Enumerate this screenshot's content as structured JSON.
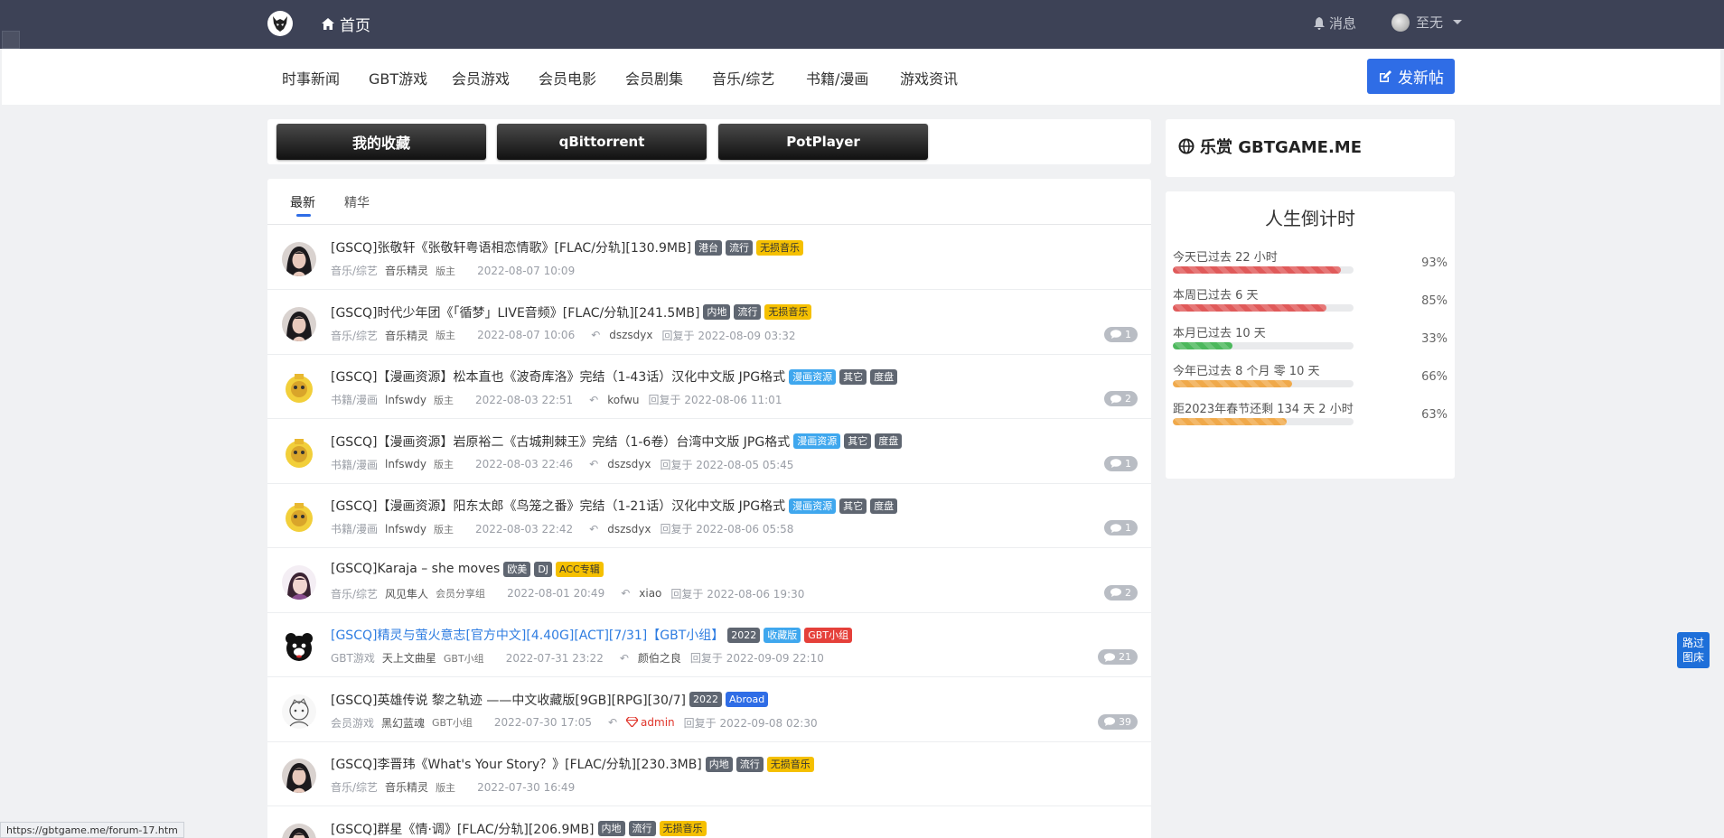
{
  "header": {
    "home_label": "首页",
    "messages_label": "消息",
    "username": "至无"
  },
  "nav": {
    "items": [
      "时事新闻",
      "GBT游戏",
      "会员游戏",
      "会员电影",
      "会员剧集",
      "音乐/综艺",
      "书籍/漫画",
      "游戏资讯"
    ],
    "post_button": "发新帖"
  },
  "quick_buttons": [
    "我的收藏",
    "qBittorrent",
    "PotPlayer"
  ],
  "tabs": [
    "最新",
    "精华"
  ],
  "threads": [
    {
      "title": "[GSCQ]张敬轩《张敬轩粤语相恋情歌》[FLAC/分轨][130.9MB]",
      "link": false,
      "tags": [
        {
          "t": "港台",
          "c": "#5f6671"
        },
        {
          "t": "流行",
          "c": "#5f6671"
        },
        {
          "t": "无损音乐",
          "c": "#f5c000",
          "dark": true
        }
      ],
      "forum": "音乐/综艺",
      "author": "音乐精灵",
      "group": "版主",
      "date": "2022-08-07 10:09",
      "replier": "",
      "reply_date": "",
      "count": "",
      "avatar": "woman"
    },
    {
      "title": "[GSCQ]时代少年团《「循梦」LIVE音频》[FLAC/分轨][241.5MB]",
      "link": false,
      "tags": [
        {
          "t": "内地",
          "c": "#5f6671"
        },
        {
          "t": "流行",
          "c": "#5f6671"
        },
        {
          "t": "无损音乐",
          "c": "#f5c000",
          "dark": true
        }
      ],
      "forum": "音乐/综艺",
      "author": "音乐精灵",
      "group": "版主",
      "date": "2022-08-07 10:06",
      "replier": "dszsdyx",
      "reply_date": "回复于 2022-08-09 03:32",
      "count": "1",
      "avatar": "woman"
    },
    {
      "title": "[GSCQ]【漫画资源】松本直也《波奇库洛》完结（1-43话）汉化中文版 JPG格式",
      "link": false,
      "tags": [
        {
          "t": "漫画资源",
          "c": "#3fa7ee"
        },
        {
          "t": "其它",
          "c": "#5f6671"
        },
        {
          "t": "度盘",
          "c": "#5f6671"
        }
      ],
      "forum": "书籍/漫画",
      "author": "lnfswdy",
      "group": "版主",
      "date": "2022-08-03 22:51",
      "replier": "kofwu",
      "reply_date": "回复于 2022-08-06 11:01",
      "count": "2",
      "avatar": "yellow"
    },
    {
      "title": "[GSCQ]【漫画资源】岩原裕二《古城荆棘王》完结（1-6卷）台湾中文版 JPG格式",
      "link": false,
      "tags": [
        {
          "t": "漫画资源",
          "c": "#3fa7ee"
        },
        {
          "t": "其它",
          "c": "#5f6671"
        },
        {
          "t": "度盘",
          "c": "#5f6671"
        }
      ],
      "forum": "书籍/漫画",
      "author": "lnfswdy",
      "group": "版主",
      "date": "2022-08-03 22:46",
      "replier": "dszsdyx",
      "reply_date": "回复于 2022-08-05 05:45",
      "count": "1",
      "avatar": "yellow"
    },
    {
      "title": "[GSCQ]【漫画资源】阳东太郎《鸟笼之番》完结（1-21话）汉化中文版 JPG格式",
      "link": false,
      "tags": [
        {
          "t": "漫画资源",
          "c": "#3fa7ee"
        },
        {
          "t": "其它",
          "c": "#5f6671"
        },
        {
          "t": "度盘",
          "c": "#5f6671"
        }
      ],
      "forum": "书籍/漫画",
      "author": "lnfswdy",
      "group": "版主",
      "date": "2022-08-03 22:42",
      "replier": "dszsdyx",
      "reply_date": "回复于 2022-08-06 05:58",
      "count": "1",
      "avatar": "yellow"
    },
    {
      "title": "[GSCQ]Karaja – she moves",
      "link": false,
      "tags": [
        {
          "t": "欧美",
          "c": "#5f6671"
        },
        {
          "t": "DJ",
          "c": "#5f6671"
        },
        {
          "t": "ACC专辑",
          "c": "#f5c000",
          "dark": true
        }
      ],
      "forum": "音乐/综艺",
      "author": "风见隼人",
      "group": "会员分享组",
      "date": "2022-08-01 20:49",
      "replier": "xiao",
      "reply_date": "回复于 2022-08-06 19:30",
      "count": "2",
      "avatar": "girl"
    },
    {
      "title": "[GSCQ]精灵与萤火意志[官方中文][4.40G][ACT][7/31]【GBT小组】",
      "link": true,
      "tags": [
        {
          "t": "2022",
          "c": "#5f6671"
        },
        {
          "t": "收藏版",
          "c": "#3fa7ee"
        },
        {
          "t": "GBT小组",
          "c": "#e5403a"
        }
      ],
      "forum": "GBT游戏",
      "author": "天上文曲星",
      "group": "GBT小组",
      "date": "2022-07-31 23:22",
      "replier": "颜伯之良",
      "reply_date": "回复于 2022-09-09 22:10",
      "count": "21",
      "avatar": "bear"
    },
    {
      "title": "[GSCQ]英雄传说 黎之轨迹 ——中文收藏版[9GB][RPG][30/7]",
      "link": false,
      "tags": [
        {
          "t": "2022",
          "c": "#5f6671"
        },
        {
          "t": "Abroad",
          "c": "#2f6de6"
        }
      ],
      "forum": "会员游戏",
      "author": "黑幻蓝魂",
      "group": "GBT小组",
      "date": "2022-07-30 17:05",
      "replier": "admin",
      "reply_date": "回复于 2022-09-08 02:30",
      "count": "39",
      "avatar": "sketch",
      "admin": true
    },
    {
      "title": "[GSCQ]李晋玮《What's Your Story？》[FLAC/分轨][230.3MB]",
      "link": false,
      "tags": [
        {
          "t": "内地",
          "c": "#5f6671"
        },
        {
          "t": "流行",
          "c": "#5f6671"
        },
        {
          "t": "无损音乐",
          "c": "#f5c000",
          "dark": true
        }
      ],
      "forum": "音乐/综艺",
      "author": "音乐精灵",
      "group": "版主",
      "date": "2022-07-30 16:49",
      "replier": "",
      "reply_date": "",
      "count": "",
      "avatar": "woman"
    },
    {
      "title": "[GSCQ]群星《情·调》[FLAC/分轨][206.9MB]",
      "link": false,
      "tags": [
        {
          "t": "内地",
          "c": "#5f6671"
        },
        {
          "t": "流行",
          "c": "#5f6671"
        },
        {
          "t": "无损音乐",
          "c": "#f5c000",
          "dark": true
        }
      ],
      "forum": "",
      "author": "",
      "group": "",
      "date": "",
      "replier": "",
      "reply_date": "",
      "count": "",
      "avatar": "woman"
    }
  ],
  "sidebar": {
    "brand": "乐赏 GBTGAME.ME",
    "countdown_title": "人生倒计时",
    "progress": [
      {
        "label": "今天已过去 22 小时",
        "pct": "93%",
        "value": 0.93,
        "color": "#e05a5a"
      },
      {
        "label": "本周已过去 6 天",
        "pct": "85%",
        "value": 0.85,
        "color": "#e05a5a"
      },
      {
        "label": "本月已过去 10 天",
        "pct": "33%",
        "value": 0.33,
        "color": "#4cb85c"
      },
      {
        "label": "今年已过去 8 个月 零 10 天",
        "pct": "66%",
        "value": 0.66,
        "color": "#f0a94a"
      },
      {
        "label": "距2023年春节还剩 134 天 2 小时",
        "pct": "63%",
        "value": 0.63,
        "color": "#f0a94a"
      }
    ]
  },
  "float_button": [
    "路过",
    "图床"
  ],
  "status_url": "https://gbtgame.me/forum-17.htm"
}
